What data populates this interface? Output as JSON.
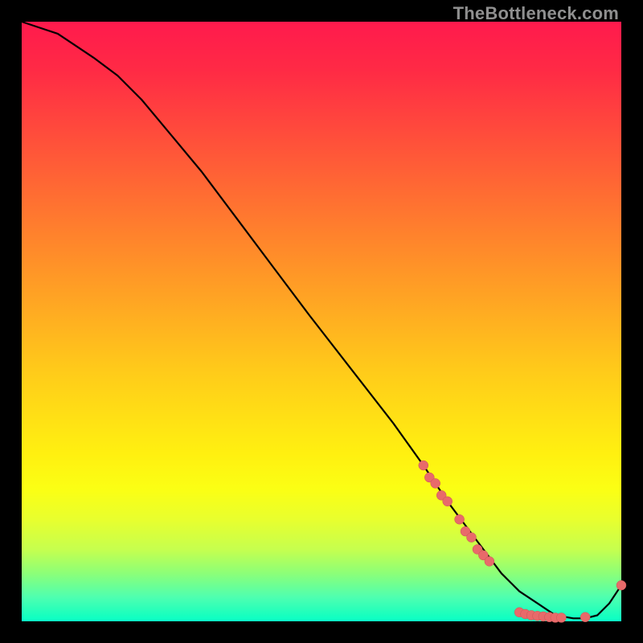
{
  "watermark": "TheBottleneck.com",
  "colors": {
    "bg": "#000000",
    "marker": "#e86a6a",
    "line": "#000000",
    "gradient_top": "#ff1a4d",
    "gradient_bottom": "#0affc8"
  },
  "chart_data": {
    "type": "line",
    "title": "",
    "xlabel": "",
    "ylabel": "",
    "xlim": [
      0,
      100
    ],
    "ylim": [
      0,
      100
    ],
    "grid": false,
    "legend": false,
    "annotations": [],
    "background": "vertical gradient red→orange→yellow→green (top→bottom)",
    "series": [
      {
        "name": "curve",
        "style": "line",
        "x": [
          0,
          3,
          6,
          9,
          12,
          16,
          20,
          25,
          30,
          36,
          42,
          48,
          55,
          62,
          67,
          71,
          74,
          77,
          80,
          83,
          86,
          89,
          92,
          94,
          96,
          98,
          100
        ],
        "y": [
          100,
          99,
          98,
          96,
          94,
          91,
          87,
          81,
          75,
          67,
          59,
          51,
          42,
          33,
          26,
          20,
          16,
          12,
          8,
          5,
          3,
          1,
          0.5,
          0.5,
          1,
          3,
          6
        ]
      },
      {
        "name": "markers",
        "style": "scatter",
        "points": [
          {
            "x": 67,
            "y": 26
          },
          {
            "x": 68,
            "y": 24
          },
          {
            "x": 69,
            "y": 23
          },
          {
            "x": 70,
            "y": 21
          },
          {
            "x": 71,
            "y": 20
          },
          {
            "x": 73,
            "y": 17
          },
          {
            "x": 74,
            "y": 15
          },
          {
            "x": 75,
            "y": 14
          },
          {
            "x": 76,
            "y": 12
          },
          {
            "x": 77,
            "y": 11
          },
          {
            "x": 78,
            "y": 10
          },
          {
            "x": 83,
            "y": 1.5
          },
          {
            "x": 84,
            "y": 1.2
          },
          {
            "x": 85,
            "y": 1.0
          },
          {
            "x": 86,
            "y": 0.9
          },
          {
            "x": 87,
            "y": 0.8
          },
          {
            "x": 88,
            "y": 0.7
          },
          {
            "x": 89,
            "y": 0.6
          },
          {
            "x": 90,
            "y": 0.6
          },
          {
            "x": 94,
            "y": 0.7
          },
          {
            "x": 100,
            "y": 6
          }
        ]
      }
    ]
  }
}
